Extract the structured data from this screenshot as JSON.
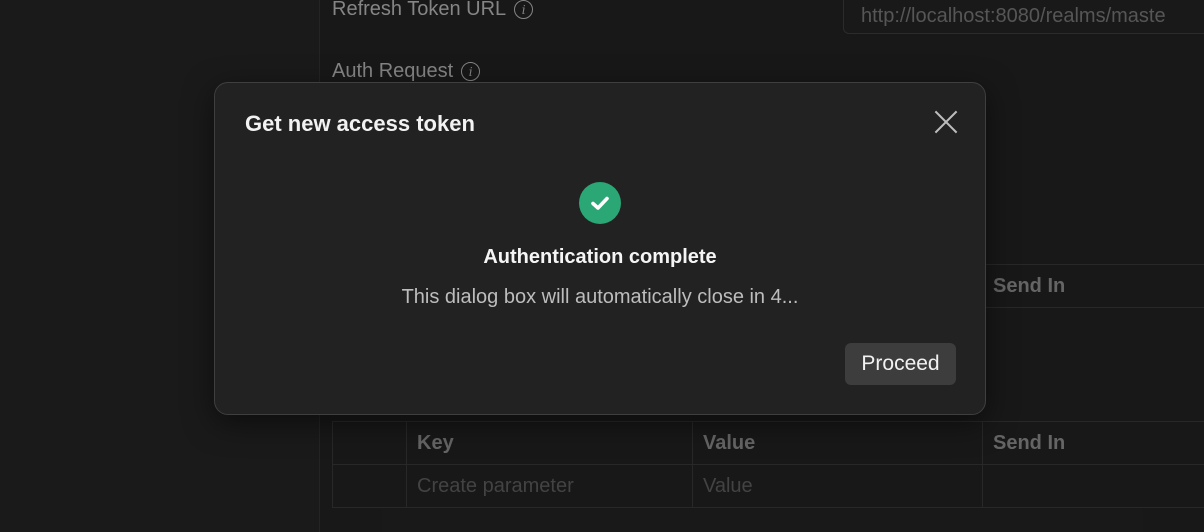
{
  "background_form": {
    "refresh_token_url_label": "Refresh Token URL",
    "refresh_token_url_value": "http://localhost:8080/realms/maste",
    "auth_request_label": "Auth Request",
    "table_upper": {
      "send_in_header": "Send In"
    },
    "table_lower": {
      "headers": [
        "Key",
        "Value",
        "Send In"
      ],
      "placeholder_row": [
        "Create parameter",
        "Value",
        ""
      ]
    }
  },
  "dialog": {
    "title": "Get new access token",
    "status_title": "Authentication complete",
    "status_message": "This dialog box will automatically close in 4...",
    "proceed_label": "Proceed",
    "icons": {
      "close": "close-icon",
      "success": "check-circle-icon"
    },
    "colors": {
      "success": "#2aa774",
      "proceed_bg": "#3d3d3d"
    }
  }
}
